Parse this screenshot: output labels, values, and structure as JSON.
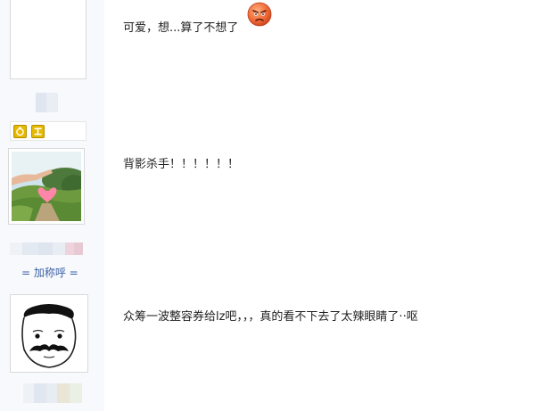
{
  "posts": [
    {
      "text": "可爱，想...算了不想了",
      "emoji": "angry-face-emoji"
    },
    {
      "text": "背影杀手！！！！！！",
      "nickname": "= 加称呼 ="
    },
    {
      "text": "众筹一波整容券给lz吧，，，真的看不下去了太辣眼睛了··呕"
    }
  ],
  "colors": {
    "sidebar_bg": "#f7f9fc",
    "link": "#3b5fa4",
    "text": "#222222",
    "badge": "#e6b800"
  },
  "icons": [
    "angry-face-emoji",
    "medal-icon",
    "tag-icon"
  ]
}
